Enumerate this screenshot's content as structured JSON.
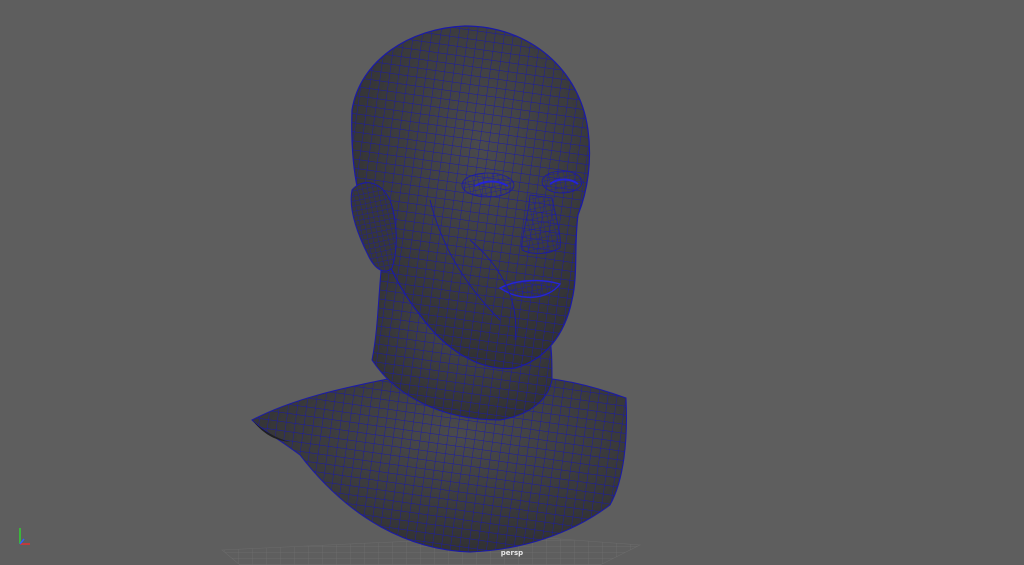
{
  "viewport": {
    "camera_label": "persp",
    "background_color": "#5e5e5e",
    "mesh_color": "#3b3b3d",
    "wireframe_color": "#1a1aa8",
    "grid_color": "#6e6e6e"
  },
  "axis_gizmo": {
    "x_color": "#e03030",
    "y_color": "#30d030",
    "z_color": "#3060ff",
    "icon": "axis-gizmo-icon"
  },
  "model": {
    "icon": "head-bust-wireframe-icon"
  }
}
